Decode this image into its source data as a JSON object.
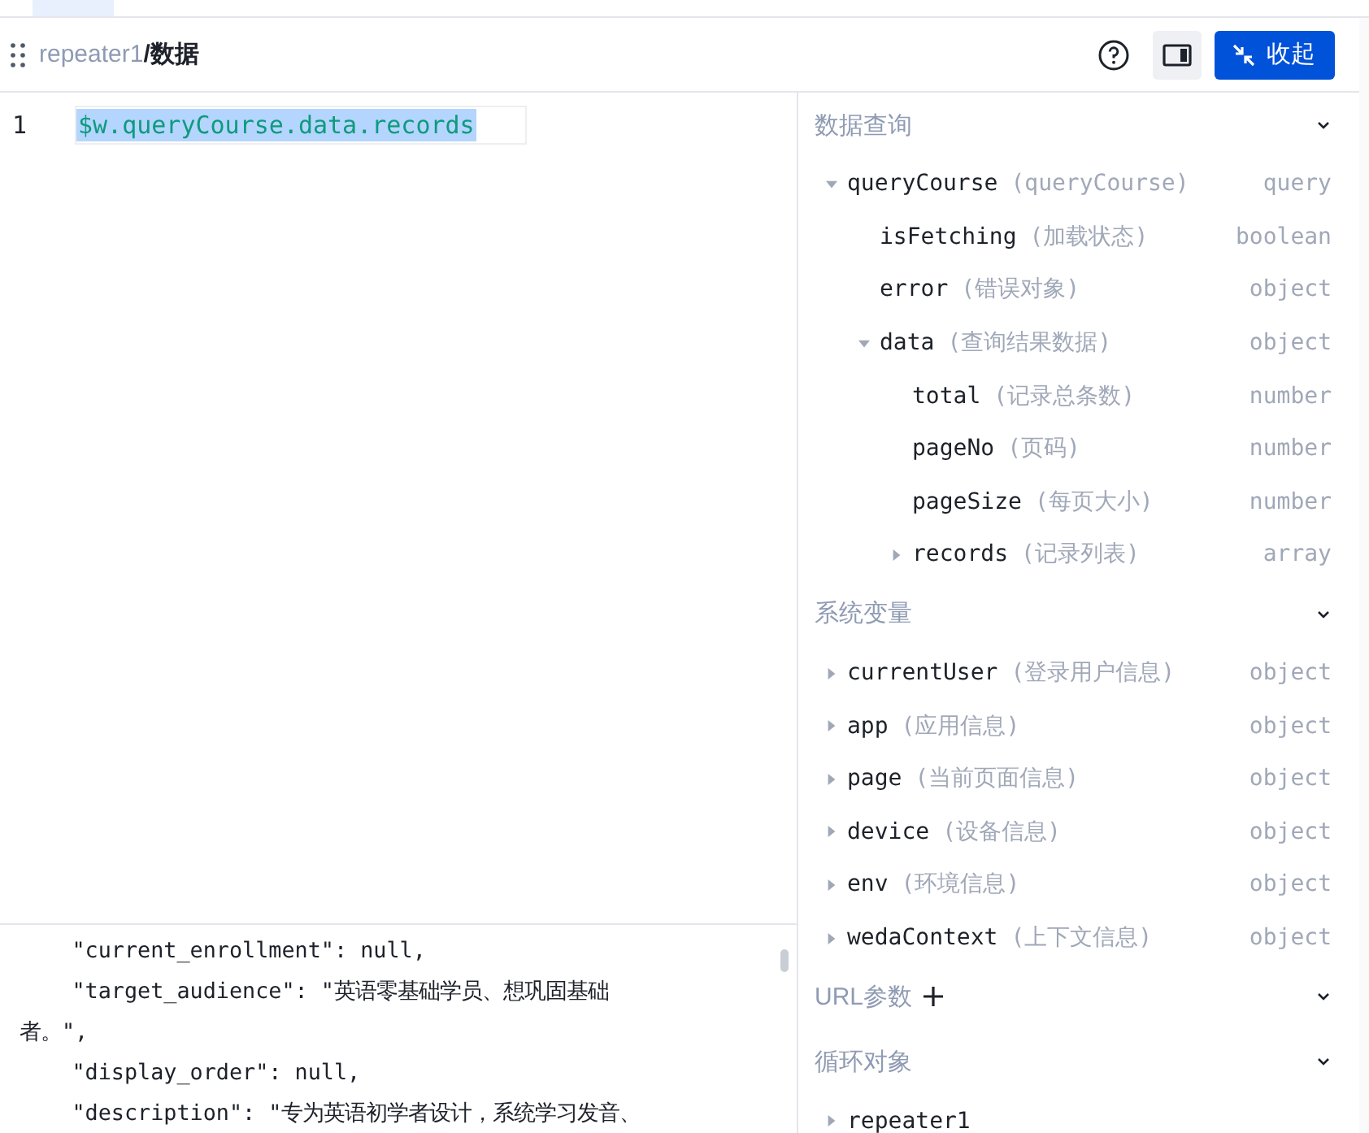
{
  "header": {
    "breadcrumb_parent": "repeater1",
    "breadcrumb_current": "/数据",
    "collapse_button": "收起"
  },
  "editor": {
    "lines": [
      {
        "number": "1",
        "code": "$w.queryCourse.data.records",
        "selected": true
      }
    ]
  },
  "preview": {
    "lines": [
      "    \"current_enrollment\": null,",
      "    \"target_audience\": \"英语零基础学员、想巩固基础",
      "者。\",",
      "    \"display_order\": null,",
      "    \"description\": \"专为英语初学者设计，系统学习发音、"
    ]
  },
  "sections": [
    {
      "title": "数据查询",
      "expanded": true,
      "items": [
        {
          "name": "queryCourse",
          "desc": "(queryCourse)",
          "type": "query",
          "expanded": true,
          "children": [
            {
              "name": "isFetching",
              "desc": "(加载状态)",
              "type": "boolean"
            },
            {
              "name": "error",
              "desc": "(错误对象)",
              "type": "object"
            },
            {
              "name": "data",
              "desc": "(查询结果数据)",
              "type": "object",
              "expanded": true,
              "children": [
                {
                  "name": "total",
                  "desc": "(记录总条数)",
                  "type": "number"
                },
                {
                  "name": "pageNo",
                  "desc": "(页码)",
                  "type": "number"
                },
                {
                  "name": "pageSize",
                  "desc": "(每页大小)",
                  "type": "number"
                },
                {
                  "name": "records",
                  "desc": "(记录列表)",
                  "type": "array",
                  "expanded": false
                }
              ]
            }
          ]
        }
      ]
    },
    {
      "title": "系统变量",
      "expanded": true,
      "items": [
        {
          "name": "currentUser",
          "desc": "(登录用户信息)",
          "type": "object",
          "expanded": false
        },
        {
          "name": "app",
          "desc": "(应用信息)",
          "type": "object",
          "expanded": false
        },
        {
          "name": "page",
          "desc": "(当前页面信息)",
          "type": "object",
          "expanded": false
        },
        {
          "name": "device",
          "desc": "(设备信息)",
          "type": "object",
          "expanded": false
        },
        {
          "name": "env",
          "desc": "(环境信息)",
          "type": "object",
          "expanded": false
        },
        {
          "name": "wedaContext",
          "desc": "(上下文信息)",
          "type": "object",
          "expanded": false
        }
      ]
    },
    {
      "title": "URL参数",
      "addable": true,
      "expanded": true
    },
    {
      "title": "循环对象",
      "expanded": true,
      "items": [
        {
          "name": "repeater1",
          "expanded": false
        }
      ]
    }
  ]
}
